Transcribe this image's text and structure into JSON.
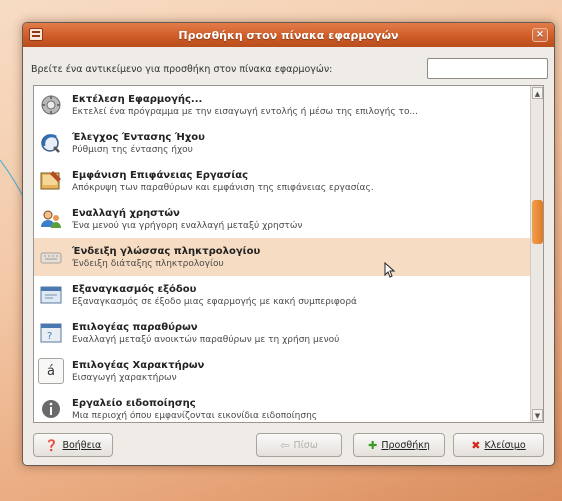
{
  "window": {
    "title": "Προσθήκη στον πίνακα εφαρμογών",
    "close_glyph": "×"
  },
  "search": {
    "label": "Βρείτε ένα αντικείμενο για προσθήκη στον πίνακα εφαρμογών:",
    "value": "",
    "placeholder": ""
  },
  "items": [
    {
      "icon": "run-application-icon",
      "title": "Εκτέλεση Εφαρμογής...",
      "desc": "Εκτελεί ένα πρόγραμμα με την εισαγωγή εντολής ή μέσω της επιλογής το..."
    },
    {
      "icon": "volume-control-icon",
      "title": "Έλεγχος Έντασης Ήχου",
      "desc": "Ρύθμιση της έντασης ήχου"
    },
    {
      "icon": "show-desktop-icon",
      "title": "Εμφάνιση Επιφάνειας Εργασίας",
      "desc": "Απόκρυψη των παραθύρων και εμφάνιση της επιφάνειας εργασίας."
    },
    {
      "icon": "switch-user-icon",
      "title": "Εναλλαγή χρηστών",
      "desc": "Ένα μενού για γρήγορη εναλλαγή μεταξύ χρηστών"
    },
    {
      "icon": "keyboard-indicator-icon",
      "title": "Ένδειξη γλώσσας πληκτρολογίου",
      "desc": "Ένδειξη διάταξης πληκτρολογίου"
    },
    {
      "icon": "force-quit-icon",
      "title": "Εξαναγκασμός εξόδου",
      "desc": "Εξαναγκασμός σε έξοδο μιας εφαρμογής με κακή συμπεριφορά"
    },
    {
      "icon": "window-selector-icon",
      "title": "Επιλογέας παραθύρων",
      "desc": "Εναλλαγή μεταξύ ανοικτών παραθύρων με τη χρήση μενού"
    },
    {
      "icon": "character-palette-icon",
      "title": "Επιλογέας Χαρακτήρων",
      "desc": "Εισαγωγή χαρακτήρων"
    },
    {
      "icon": "notification-area-icon",
      "title": "Εργαλείο ειδοποίησης",
      "desc": "Μια περιοχή όπου εμφανίζονται εικονίδια ειδοποίησης"
    }
  ],
  "buttons": {
    "help": "Βοήθεια",
    "back": "Πίσω",
    "add": "Προσθήκη",
    "close": "Κλείσιμο"
  }
}
